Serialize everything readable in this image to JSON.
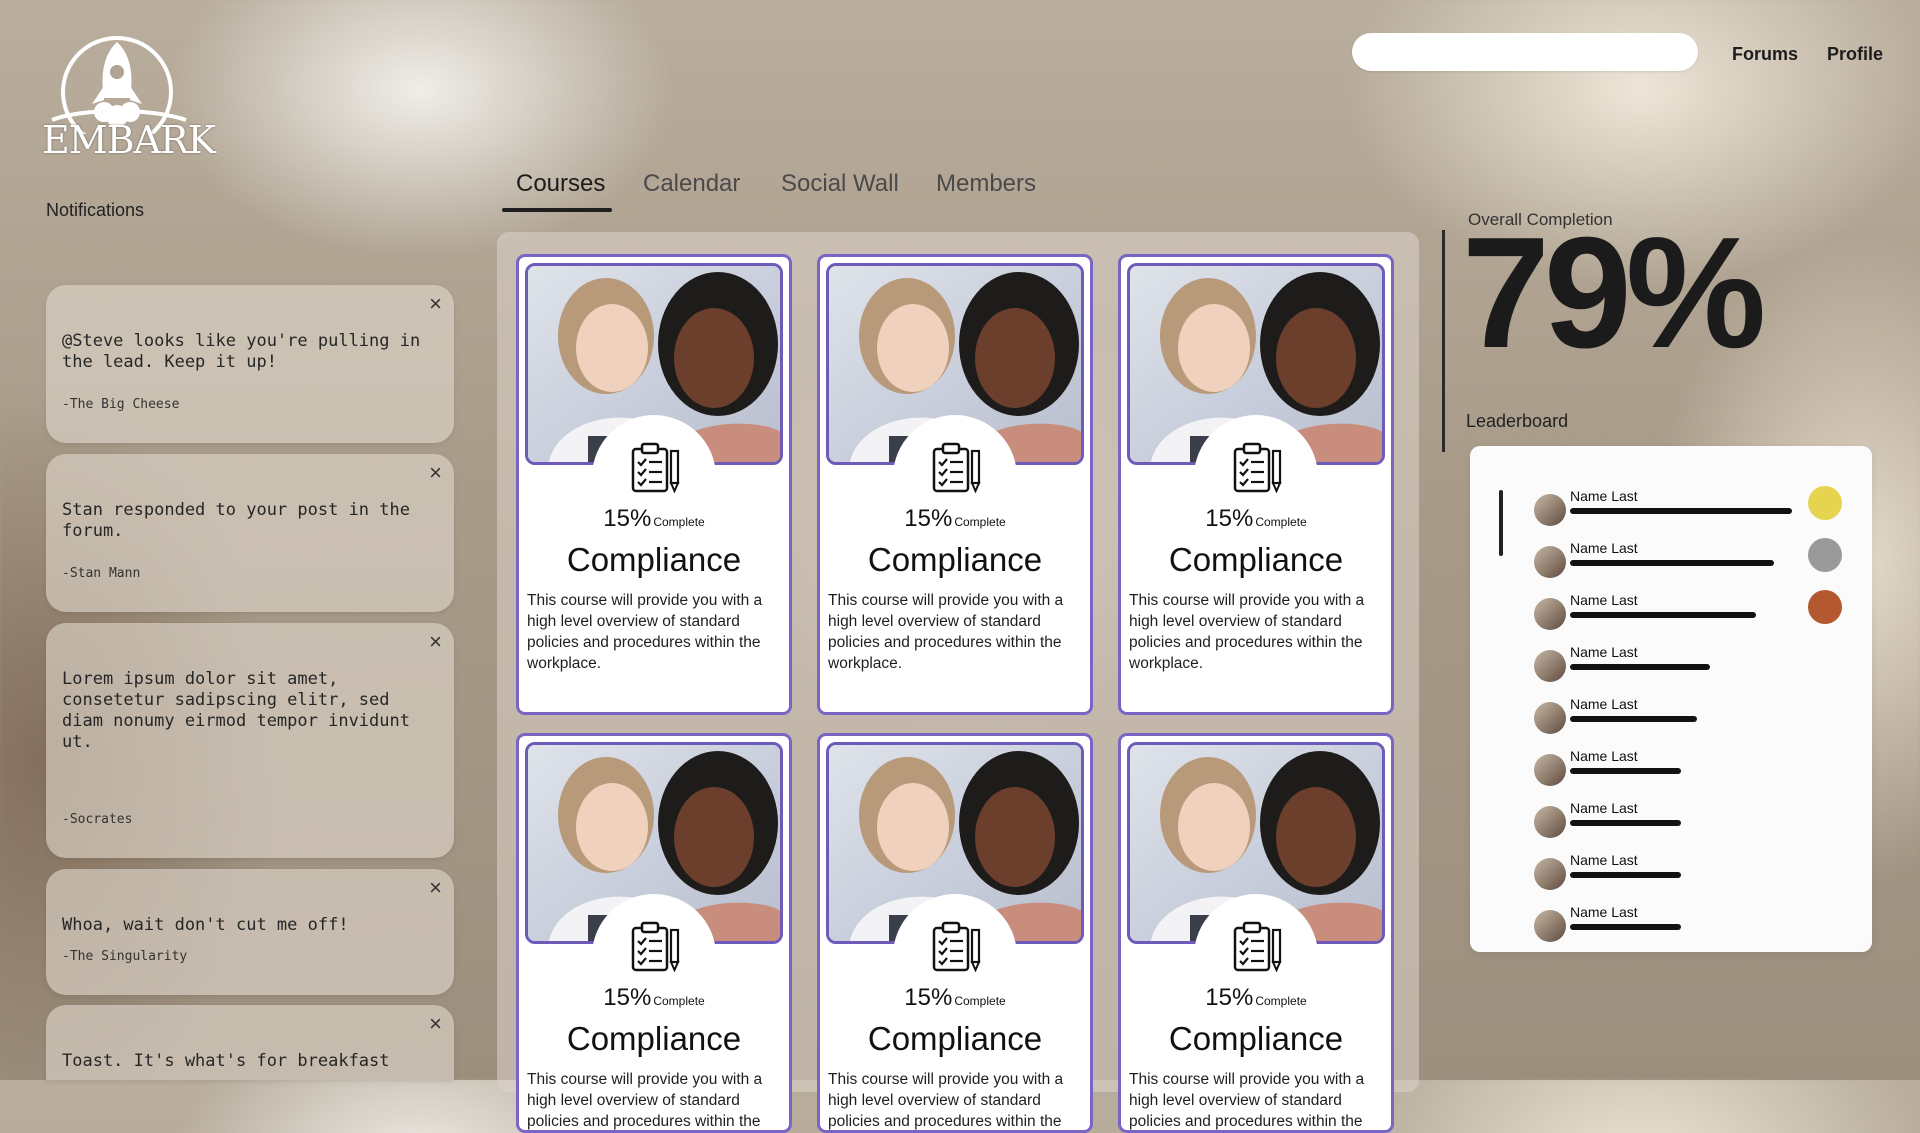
{
  "brand": {
    "logo_text": "EMBARK"
  },
  "topnav": {
    "search_placeholder": "",
    "forums_label": "Forums",
    "profile_label": "Profile"
  },
  "notifications": {
    "heading": "Notifications",
    "close_label": "×",
    "items": [
      {
        "message": "@Steve looks like you're pulling in the lead. Keep it up!",
        "from": "-The Big Cheese"
      },
      {
        "message": "Stan responded to your post in the forum.",
        "from": "-Stan Mann"
      },
      {
        "message": "Lorem ipsum dolor sit amet, consetetur sadipscing elitr, sed diam nonumy eirmod tempor invidunt ut.",
        "from": "-Socrates"
      },
      {
        "message": "Whoa, wait don't cut me off!",
        "from": "-The Singularity"
      },
      {
        "message": "Toast. It's what's for breakfast",
        "from": ""
      }
    ]
  },
  "tabs": [
    {
      "label": "Courses",
      "active": true
    },
    {
      "label": "Calendar",
      "active": false
    },
    {
      "label": "Social Wall",
      "active": false
    },
    {
      "label": "Members",
      "active": false
    }
  ],
  "courses": [
    {
      "percent": "15%",
      "percent_label": "Complete",
      "title": "Compliance",
      "description": "This course will provide you with a high level overview of standard policies and procedures within the workplace.",
      "icon": "clipboard-icon"
    },
    {
      "percent": "15%",
      "percent_label": "Complete",
      "title": "Compliance",
      "description": "This course will provide you with a high level overview of standard policies and procedures within the workplace.",
      "icon": "clipboard-icon"
    },
    {
      "percent": "15%",
      "percent_label": "Complete",
      "title": "Compliance",
      "description": "This course will provide you with a high level overview of standard policies and procedures within the workplace.",
      "icon": "clipboard-icon"
    },
    {
      "percent": "15%",
      "percent_label": "Complete",
      "title": "Compliance",
      "description": "This course will provide you with a high level overview of standard policies and procedures within the workplace.",
      "icon": "clipboard-icon"
    },
    {
      "percent": "15%",
      "percent_label": "Complete",
      "title": "Compliance",
      "description": "This course will provide you with a high level overview of standard policies and procedures within the workplace.",
      "icon": "clipboard-icon"
    },
    {
      "percent": "15%",
      "percent_label": "Complete",
      "title": "Compliance",
      "description": "This course will provide you with a high level overview of standard policies and procedures within the workplace.",
      "icon": "clipboard-icon"
    }
  ],
  "overall": {
    "label": "Overall Completion",
    "value": "79%"
  },
  "leaderboard": {
    "label": "Leaderboard",
    "rows": [
      {
        "name": "Name Last",
        "score": 1.0,
        "medal": "#e6d451"
      },
      {
        "name": "Name Last",
        "score": 0.92,
        "medal": "#9a9a9a"
      },
      {
        "name": "Name Last",
        "score": 0.84,
        "medal": "#b4582f"
      },
      {
        "name": "Name Last",
        "score": 0.63,
        "medal": null
      },
      {
        "name": "Name Last",
        "score": 0.57,
        "medal": null
      },
      {
        "name": "Name Last",
        "score": 0.5,
        "medal": null
      },
      {
        "name": "Name Last",
        "score": 0.5,
        "medal": null
      },
      {
        "name": "Name Last",
        "score": 0.5,
        "medal": null
      },
      {
        "name": "Name Last",
        "score": 0.5,
        "medal": null
      }
    ]
  },
  "colors": {
    "card_border": "#7a64c4",
    "gold": "#e6d451",
    "silver": "#9a9a9a",
    "bronze": "#b4582f"
  }
}
